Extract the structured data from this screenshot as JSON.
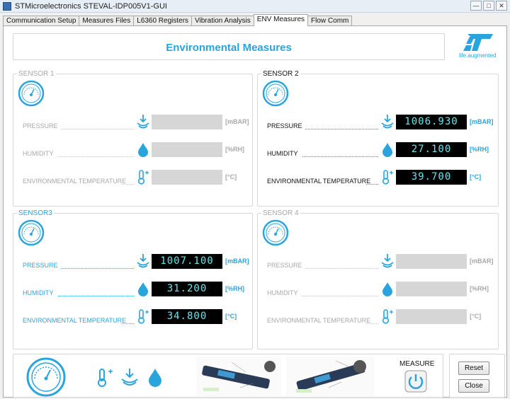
{
  "window": {
    "title": "STMicroelectronics STEVAL-IDP005V1-GUI",
    "buttons": [
      "—",
      "□",
      "✕"
    ]
  },
  "tabs": [
    {
      "label": "Communication Setup",
      "active": false
    },
    {
      "label": "Measures Files",
      "active": false
    },
    {
      "label": "L6360 Registers",
      "active": false
    },
    {
      "label": "Vibration Analysis",
      "active": false
    },
    {
      "label": "ENV Measures",
      "active": true
    },
    {
      "label": "Flow Comm",
      "active": false
    }
  ],
  "header": {
    "title": "Environmental Measures",
    "logo_text": "life.augmented",
    "logo_mark": "ST"
  },
  "sensors": [
    {
      "label": "SENSOR 1",
      "enabled": false,
      "rows": [
        {
          "label": "PRESSURE",
          "value": "",
          "unit": "[mBAR]",
          "icon": "pressure-icon"
        },
        {
          "label": "HUMIDITY",
          "value": "",
          "unit": "[%RH]",
          "icon": "humidity-icon"
        },
        {
          "label": "ENVIRONMENTAL TEMPERATURE",
          "value": "",
          "unit": "[°C]",
          "icon": "temperature-icon"
        }
      ]
    },
    {
      "label": "SENSOR 2",
      "enabled": true,
      "rows": [
        {
          "label": "PRESSURE",
          "value": "1006.930",
          "unit": "[mBAR]",
          "icon": "pressure-icon"
        },
        {
          "label": "HUMIDITY",
          "value": "27.100",
          "unit": "[%RH]",
          "icon": "humidity-icon"
        },
        {
          "label": "ENVIRONMENTAL TEMPERATURE",
          "value": "39.700",
          "unit": "[°C]",
          "icon": "temperature-icon"
        }
      ]
    },
    {
      "label": "SENSOR3",
      "enabled": true,
      "rows": [
        {
          "label": "PRESSURE",
          "value": "1007.100",
          "unit": "[mBAR]",
          "icon": "pressure-icon"
        },
        {
          "label": "HUMIDITY",
          "value": "31.200",
          "unit": "[%RH]",
          "icon": "humidity-icon"
        },
        {
          "label": "ENVIRONMENTAL TEMPERATURE",
          "value": "34.800",
          "unit": "[°C]",
          "icon": "temperature-icon"
        }
      ]
    },
    {
      "label": "SENSOR 4",
      "enabled": false,
      "rows": [
        {
          "label": "PRESSURE",
          "value": "",
          "unit": "[mBAR]",
          "icon": "pressure-icon"
        },
        {
          "label": "HUMIDITY",
          "value": "",
          "unit": "[%RH]",
          "icon": "humidity-icon"
        },
        {
          "label": "ENVIRONMENTAL TEMPERATURE",
          "value": "",
          "unit": "[°C]",
          "icon": "temperature-icon"
        }
      ]
    }
  ],
  "controls": {
    "measure_label": "MEASURE",
    "reset_label": "Reset",
    "close_label": "Close"
  },
  "colors": {
    "accent": "#2aa4dc",
    "label_active": "#2aa4dc",
    "label_disabled": "#a8a8a8",
    "value_text": "#67e5ee",
    "value_bg": "#000000",
    "value_empty": "#d6d6d6"
  }
}
